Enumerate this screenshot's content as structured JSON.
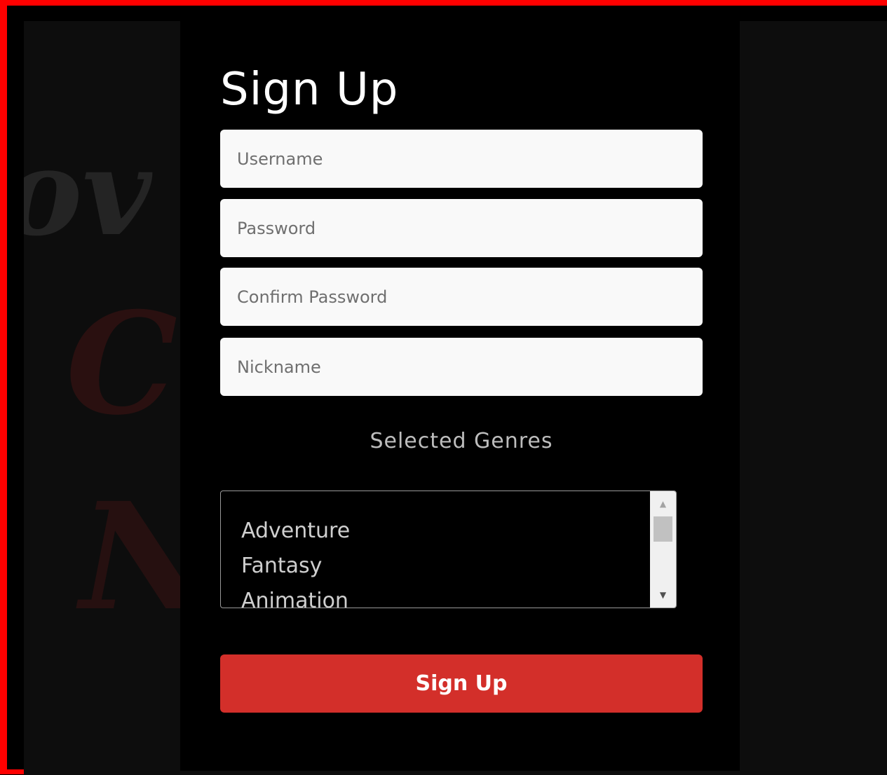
{
  "form": {
    "title": "Sign Up",
    "fields": {
      "username_placeholder": "Username",
      "password_placeholder": "Password",
      "confirm_password_placeholder": "Confirm Password",
      "nickname_placeholder": "Nickname"
    },
    "genres": {
      "label": "Selected Genres",
      "options": [
        "Adventure",
        "Fantasy",
        "Animation"
      ]
    },
    "submit_label": "Sign Up"
  },
  "colors": {
    "frame": "#ff0000",
    "accent": "#d32f2a",
    "panel": "#000000",
    "background": "#0d0d0d"
  }
}
